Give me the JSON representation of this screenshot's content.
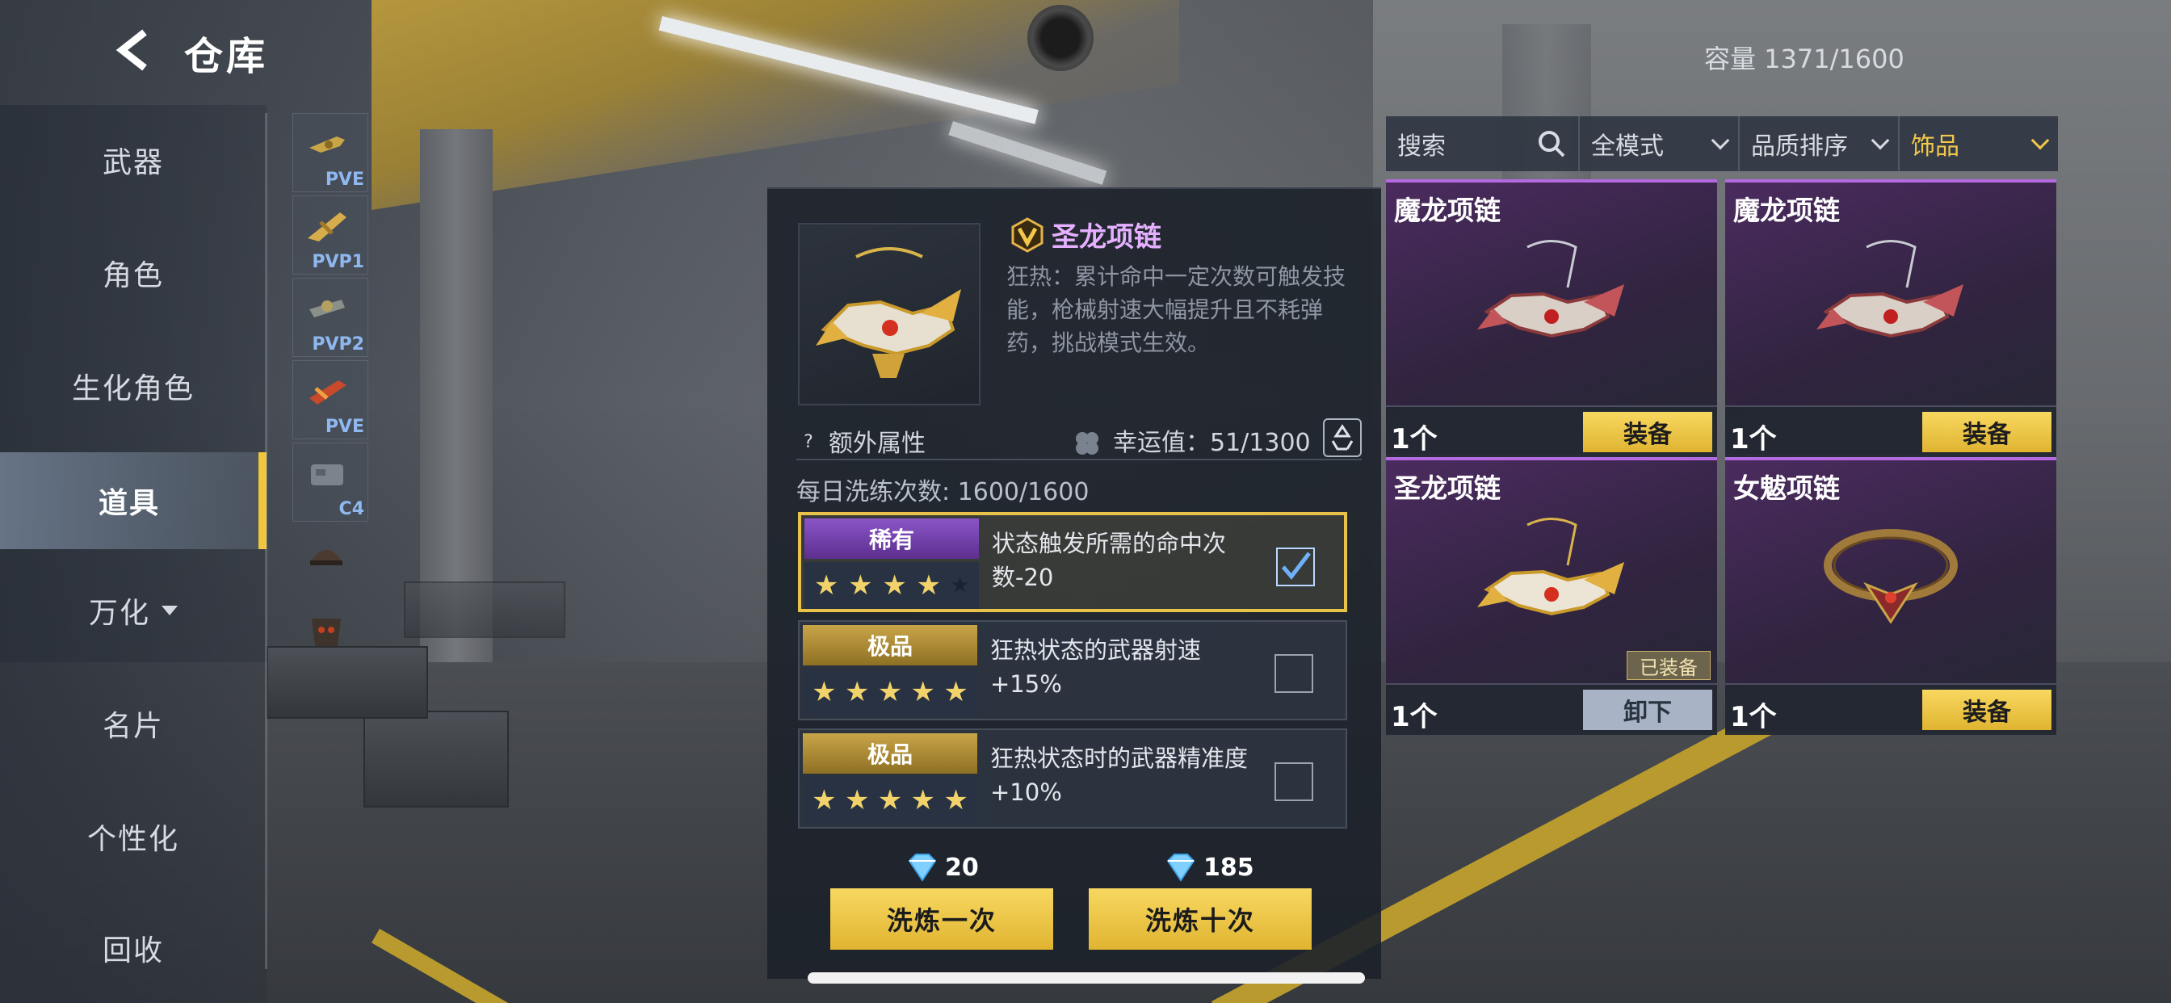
{
  "header": {
    "title": "仓库",
    "capacity": "容量  1371/1600"
  },
  "nav": {
    "items": [
      {
        "label": "武器"
      },
      {
        "label": "角色"
      },
      {
        "label": "生化角色"
      },
      {
        "label": "道具"
      },
      {
        "label": "万化"
      },
      {
        "label": "名片"
      },
      {
        "label": "个性化"
      },
      {
        "label": "回收"
      }
    ],
    "active_index": 3
  },
  "subcategories": [
    {
      "label": "PVE"
    },
    {
      "label": "PVP1"
    },
    {
      "label": "PVP2"
    },
    {
      "label": "PVE"
    },
    {
      "label": "C4"
    },
    {
      "label": ""
    },
    {
      "label": ""
    }
  ],
  "detail": {
    "name": "圣龙项链",
    "description": "狂热：累计命中一定次数可触发技能，枪械射速大幅提升且不耗弹药，挑战模式生效。",
    "extra_label": "额外属性",
    "luck": "幸运值：51/1300",
    "daily_wash": "每日洗练次数:  1600/1600",
    "attributes": [
      {
        "grade": "稀有",
        "stars": 4,
        "text": "状态触发所需的命中次数-20",
        "checked": true
      },
      {
        "grade": "极品",
        "stars": 5,
        "text": "狂热状态的武器射速+15%",
        "checked": false
      },
      {
        "grade": "极品",
        "stars": 5,
        "text": "狂热状态时的武器精准度+10%",
        "checked": false
      }
    ],
    "wash_once": {
      "price": "20",
      "label": "洗炼一次"
    },
    "wash_ten": {
      "price": "185",
      "label": "洗炼十次"
    }
  },
  "filters": {
    "search_placeholder": "搜索",
    "mode": "全模式",
    "sort": "品质排序",
    "category": "饰品"
  },
  "cards": [
    {
      "name": "魔龙项链",
      "count": "1个",
      "button": "装备",
      "equipped": false,
      "badge": ""
    },
    {
      "name": "魔龙项链",
      "count": "1个",
      "button": "装备",
      "equipped": false,
      "badge": ""
    },
    {
      "name": "圣龙项链",
      "count": "1个",
      "button": "卸下",
      "equipped": true,
      "badge": "已装备"
    },
    {
      "name": "女魃项链",
      "count": "1个",
      "button": "装备",
      "equipped": false,
      "badge": ""
    }
  ],
  "colors": {
    "accent_gold": "#f1c84a",
    "rare_purple": "#8a55c8",
    "epic_gold": "#c9a548"
  }
}
